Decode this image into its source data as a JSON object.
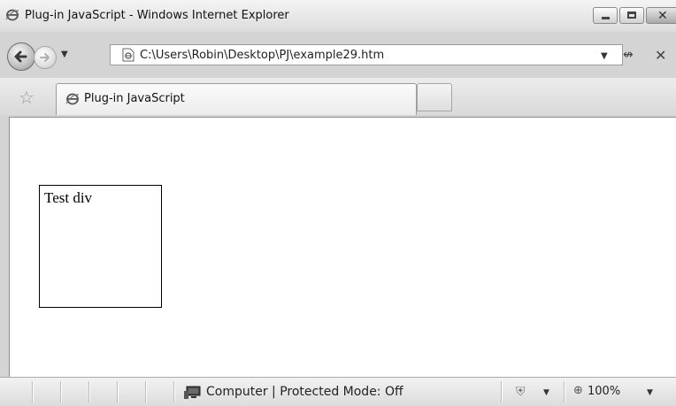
{
  "window": {
    "title": "Plug-in JavaScript - Windows Internet Explorer"
  },
  "address_bar": {
    "url": "C:\\Users\\Robin\\Desktop\\PJ\\example29.htm"
  },
  "tabs": [
    {
      "label": "Plug-in JavaScript",
      "active": true
    }
  ],
  "page": {
    "test_div_text": "Test div"
  },
  "status_bar": {
    "zone_text": "Computer | Protected Mode: Off",
    "zoom": "100%"
  },
  "icons": {
    "title": "ie-logo-icon",
    "back": "back-arrow-icon",
    "forward": "forward-arrow-icon",
    "page": "page-icon",
    "refresh": "refresh-icon",
    "stop": "stop-icon",
    "favorites": "star-icon",
    "tab": "ie-logo-icon",
    "computer": "monitor-icon",
    "security": "shield-icon",
    "zoom": "zoom-icon"
  },
  "colors": {
    "chrome_bg": "#d4d4d4",
    "page_bg": "#ffffff",
    "border": "#8d8d8d"
  }
}
